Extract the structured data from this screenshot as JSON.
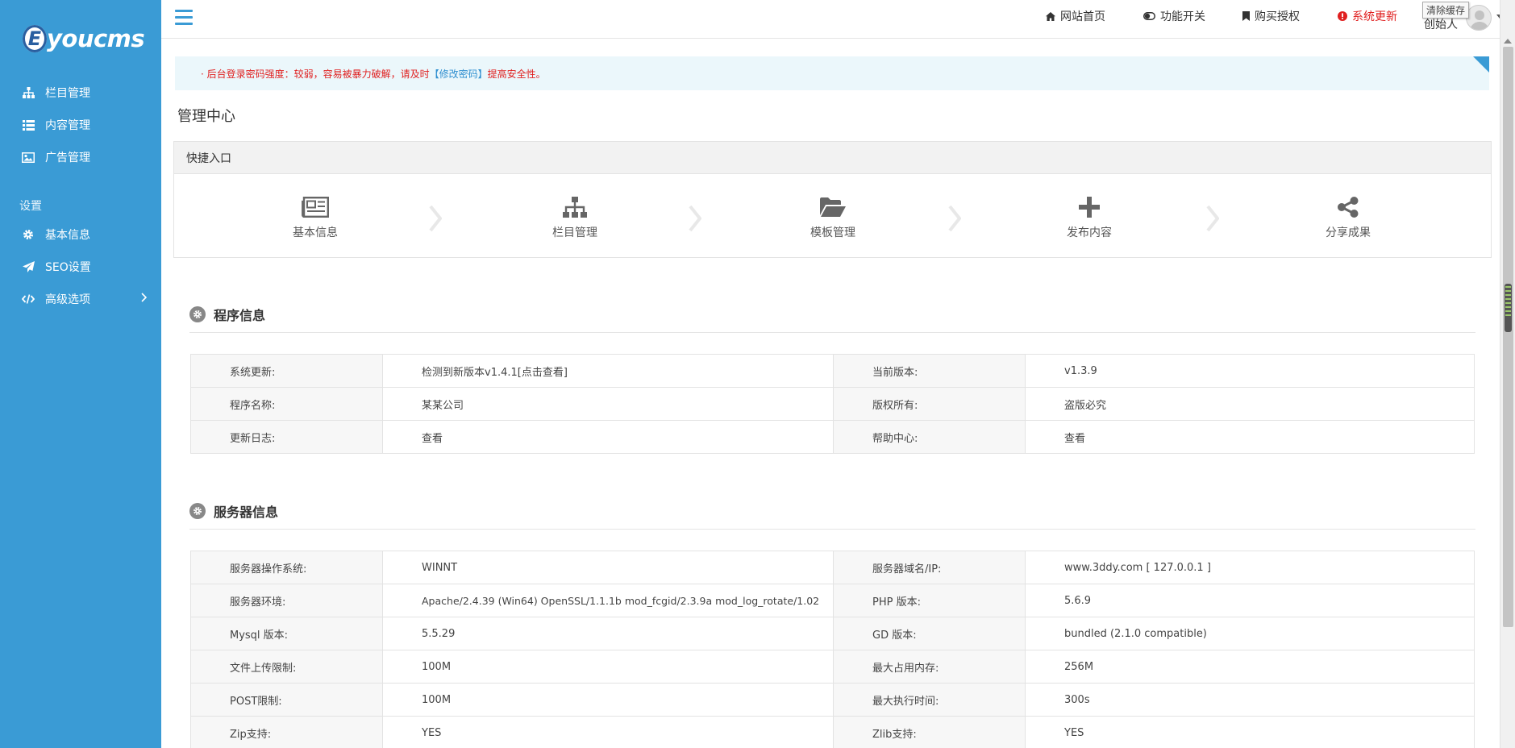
{
  "brand": {
    "logo_letter": "E",
    "logo_text": "youcms"
  },
  "sidebar": {
    "items": [
      {
        "label": "栏目管理",
        "icon": "sitemap-icon"
      },
      {
        "label": "内容管理",
        "icon": "list-icon"
      },
      {
        "label": "广告管理",
        "icon": "image-icon"
      }
    ],
    "section_label": "设置",
    "settings": [
      {
        "label": "基本信息",
        "icon": "gear-icon"
      },
      {
        "label": "SEO设置",
        "icon": "paper-plane-icon"
      },
      {
        "label": "高级选项",
        "icon": "code-icon"
      }
    ]
  },
  "header": {
    "links": [
      {
        "label": "网站首页",
        "icon": "home-icon"
      },
      {
        "label": "功能开关",
        "icon": "toggle-icon"
      },
      {
        "label": "购买授权",
        "icon": "bookmark-icon"
      },
      {
        "label": "系统更新",
        "icon": "exclamation-circle-icon"
      }
    ],
    "tooltip": "清除缓存",
    "user_name": "创始人"
  },
  "notice": {
    "prefix": "· 后台登录密码强度：较弱，容易被暴力破解，请及时",
    "link": "【修改密码】",
    "suffix": "提高安全性。"
  },
  "page_title": "管理中心",
  "quick": {
    "title": "快捷入口",
    "items": [
      {
        "label": "基本信息",
        "icon": "newspaper-icon"
      },
      {
        "label": "栏目管理",
        "icon": "sitemap-icon"
      },
      {
        "label": "模板管理",
        "icon": "folder-open-icon"
      },
      {
        "label": "发布内容",
        "icon": "plus-icon"
      },
      {
        "label": "分享成果",
        "icon": "share-icon"
      }
    ]
  },
  "program_info": {
    "title": "程序信息",
    "rows": [
      {
        "k1": "系统更新:",
        "v1": "检测到新版本v1.4.1[点击查看]",
        "k2": "当前版本:",
        "v2": "v1.3.9"
      },
      {
        "k1": "程序名称:",
        "v1": "某某公司",
        "k2": "版权所有:",
        "v2": "盗版必究"
      },
      {
        "k1": "更新日志:",
        "v1": "查看",
        "k2": "帮助中心:",
        "v2": "查看"
      }
    ]
  },
  "server_info": {
    "title": "服务器信息",
    "rows": [
      {
        "k1": "服务器操作系统:",
        "v1": "WINNT",
        "k2": "服务器域名/IP:",
        "v2": "www.3ddy.com [ 127.0.0.1 ]"
      },
      {
        "k1": "服务器环境:",
        "v1": "Apache/2.4.39 (Win64) OpenSSL/1.1.1b mod_fcgid/2.3.9a mod_log_rotate/1.02",
        "k2": "PHP 版本:",
        "v2": "5.6.9"
      },
      {
        "k1": "Mysql 版本:",
        "v1": "5.5.29",
        "k2": "GD 版本:",
        "v2": "bundled (2.1.0 compatible)"
      },
      {
        "k1": "文件上传限制:",
        "v1": "100M",
        "k2": "最大占用内存:",
        "v2": "256M"
      },
      {
        "k1": "POST限制:",
        "v1": "100M",
        "k2": "最大执行时间:",
        "v2": "300s"
      },
      {
        "k1": "Zip支持:",
        "v1": "YES",
        "k2": "Zlib支持:",
        "v2": "YES"
      }
    ]
  },
  "colors": {
    "sidebar": "#3a9bd5",
    "alert": "#e02020",
    "link": "#2f8fd0"
  }
}
